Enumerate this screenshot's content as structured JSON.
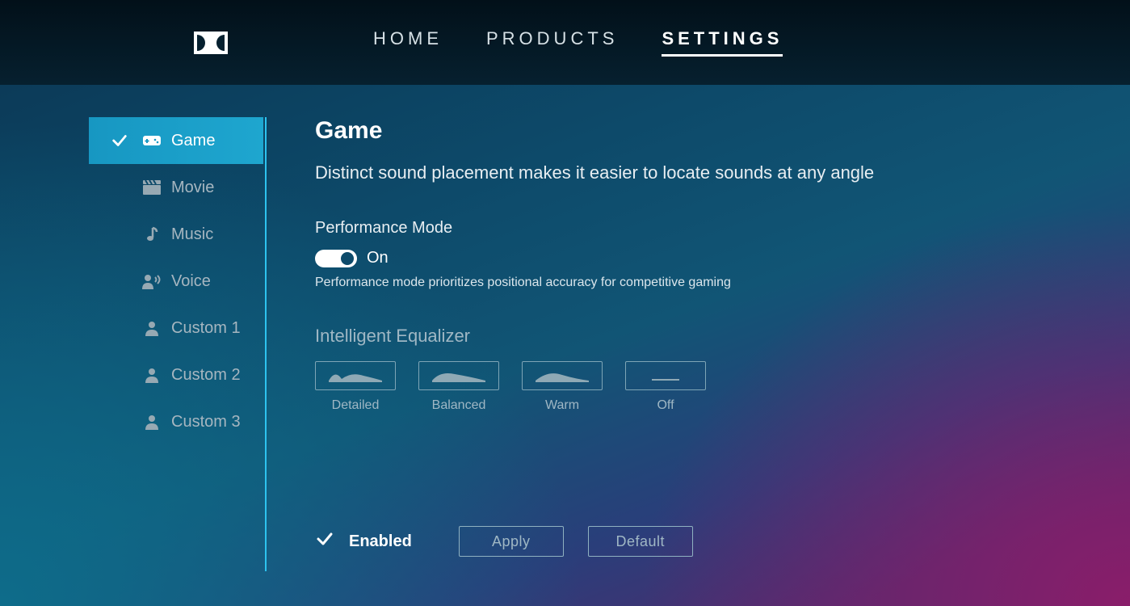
{
  "nav": {
    "home": "HOME",
    "products": "PRODUCTS",
    "settings": "SETTINGS"
  },
  "sidebar": {
    "items": [
      {
        "label": "Game"
      },
      {
        "label": "Movie"
      },
      {
        "label": "Music"
      },
      {
        "label": "Voice"
      },
      {
        "label": "Custom 1"
      },
      {
        "label": "Custom 2"
      },
      {
        "label": "Custom 3"
      }
    ]
  },
  "main": {
    "title": "Game",
    "description": "Distinct sound placement makes it easier to locate sounds at any angle",
    "performance": {
      "label": "Performance Mode",
      "state_text": "On",
      "note": "Performance mode prioritizes positional accuracy for competitive gaming"
    },
    "eq": {
      "label": "Intelligent Equalizer",
      "options": [
        {
          "label": "Detailed"
        },
        {
          "label": "Balanced"
        },
        {
          "label": "Warm"
        },
        {
          "label": "Off"
        }
      ]
    },
    "footer": {
      "enabled_label": "Enabled",
      "apply": "Apply",
      "default": "Default"
    }
  }
}
